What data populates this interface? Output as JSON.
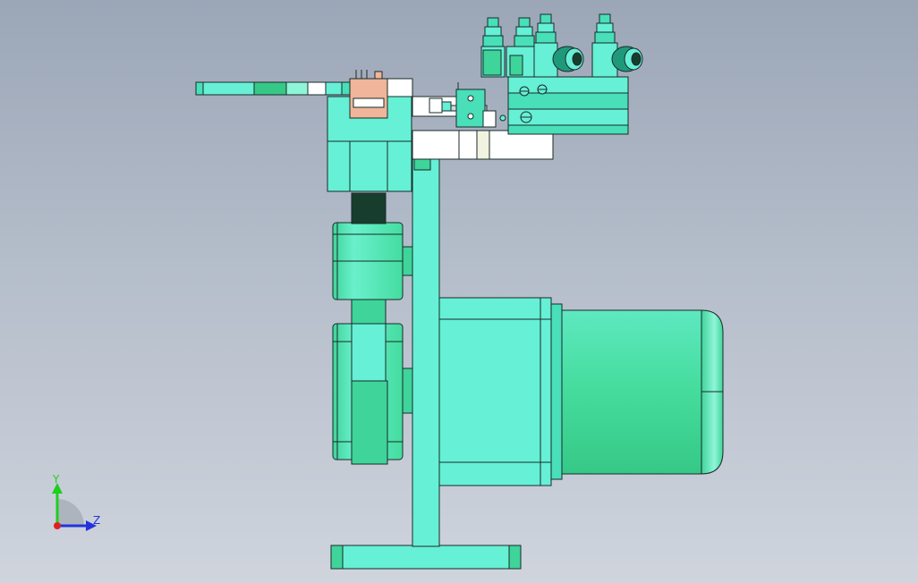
{
  "view": {
    "background_top": "#9ba6b7",
    "background_bottom": "#cfd4dd"
  },
  "model": {
    "part_color": "#66f0d6",
    "part_dark": "#3fd49a",
    "part_shade": "#48dfb9",
    "edge_color": "#1a2a2a",
    "accent_color": "#f0b59a",
    "white_block_color": "#ffffff"
  },
  "triad": {
    "y_label": "Y",
    "z_label": "Z",
    "y_color": "#1ecf1e",
    "z_color": "#2233dd",
    "origin_color": "#e02020"
  }
}
